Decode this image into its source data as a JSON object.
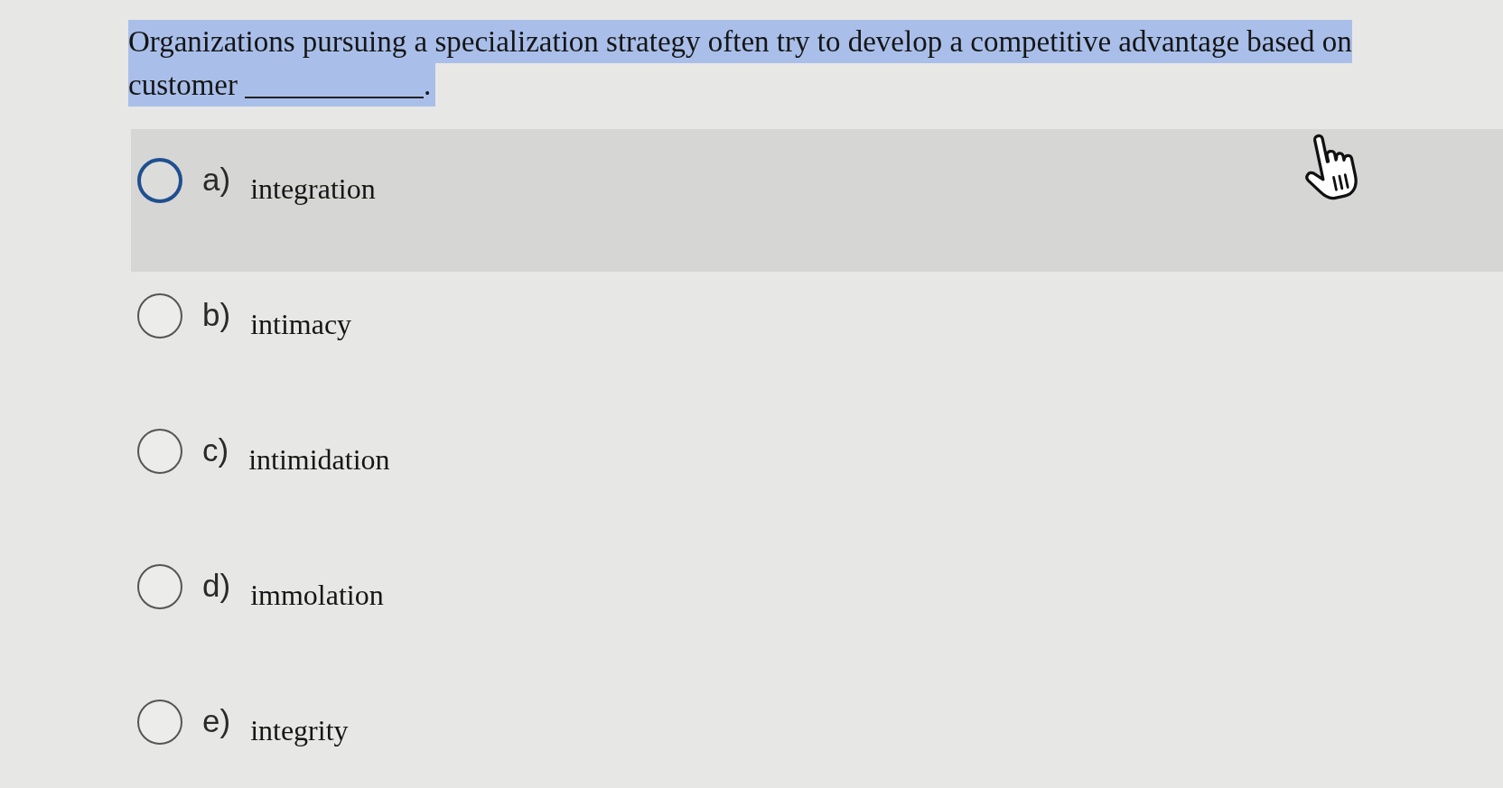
{
  "question": {
    "text": "Organizations pursuing a specialization strategy often try to develop a competitive advantage based on",
    "before_blank": "customer",
    "after_blank": ".",
    "highlighted": true
  },
  "options": [
    {
      "letter": "a)",
      "text": "integration",
      "selected": false,
      "hovered": true
    },
    {
      "letter": "b)",
      "text": "intimacy",
      "selected": false,
      "hovered": false
    },
    {
      "letter": "c)",
      "text": "intimidation",
      "selected": false,
      "hovered": false
    },
    {
      "letter": "d)",
      "text": "immolation",
      "selected": false,
      "hovered": false
    },
    {
      "letter": "e)",
      "text": "integrity",
      "selected": false,
      "hovered": false
    }
  ]
}
